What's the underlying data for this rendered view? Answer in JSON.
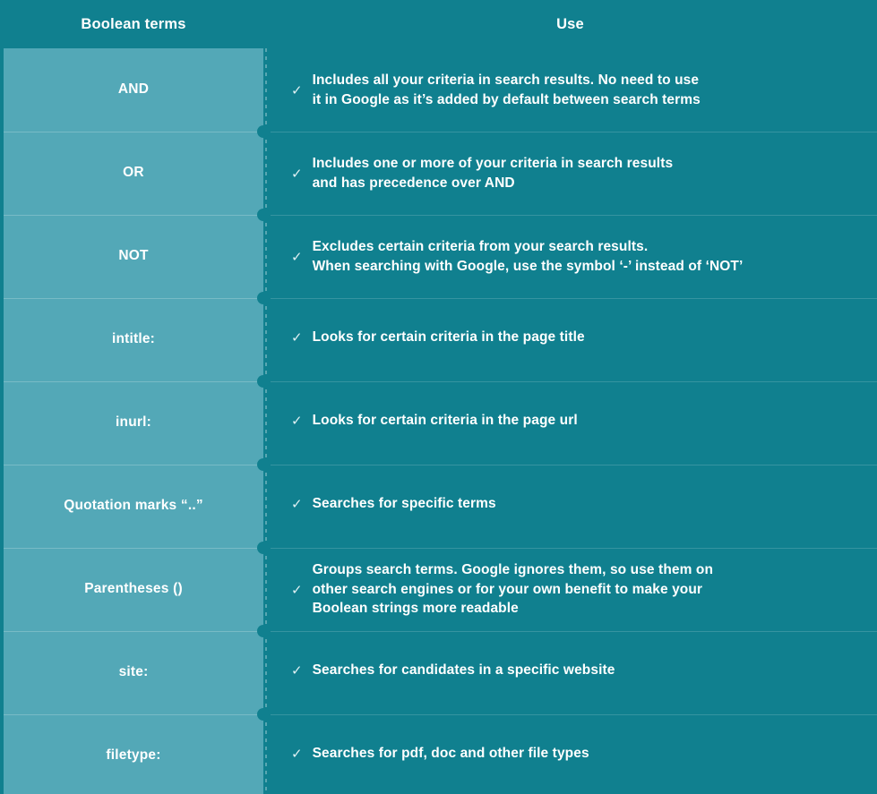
{
  "header": {
    "term_column": "Boolean terms",
    "use_column": "Use"
  },
  "colors": {
    "background_dark_teal": "#10808f",
    "stub_light_teal": "#53a8b7",
    "text": "#ffffff"
  },
  "icons": {
    "check": "✓"
  },
  "rows": [
    {
      "term": "AND",
      "use": "Includes all your criteria in search results. No need to use\nit in Google as it’s added by default between search terms",
      "lines": 2
    },
    {
      "term": "OR",
      "use": "Includes one or more of your criteria in search results\nand has precedence over AND",
      "lines": 2
    },
    {
      "term": "NOT",
      "use": "Excludes certain criteria from your search results.\nWhen searching with Google, use the symbol ‘-’ instead of ‘NOT’",
      "lines": 2
    },
    {
      "term": "intitle:",
      "use": "Looks for certain criteria in the page title",
      "lines": 1
    },
    {
      "term": "inurl:",
      "use": "Looks for certain criteria in the page url",
      "lines": 1
    },
    {
      "term": "Quotation marks “..”",
      "use": "Searches for specific terms",
      "lines": 1
    },
    {
      "term": "Parentheses ()",
      "use": "Groups search terms. Google ignores them, so use them on\nother search engines or for your own benefit to make your\nBoolean strings more readable",
      "lines": 3
    },
    {
      "term": "site:",
      "use": "Searches for candidates in a specific website",
      "lines": 1
    },
    {
      "term": "filetype:",
      "use": "Searches for pdf, doc and other file types",
      "lines": 1
    }
  ]
}
